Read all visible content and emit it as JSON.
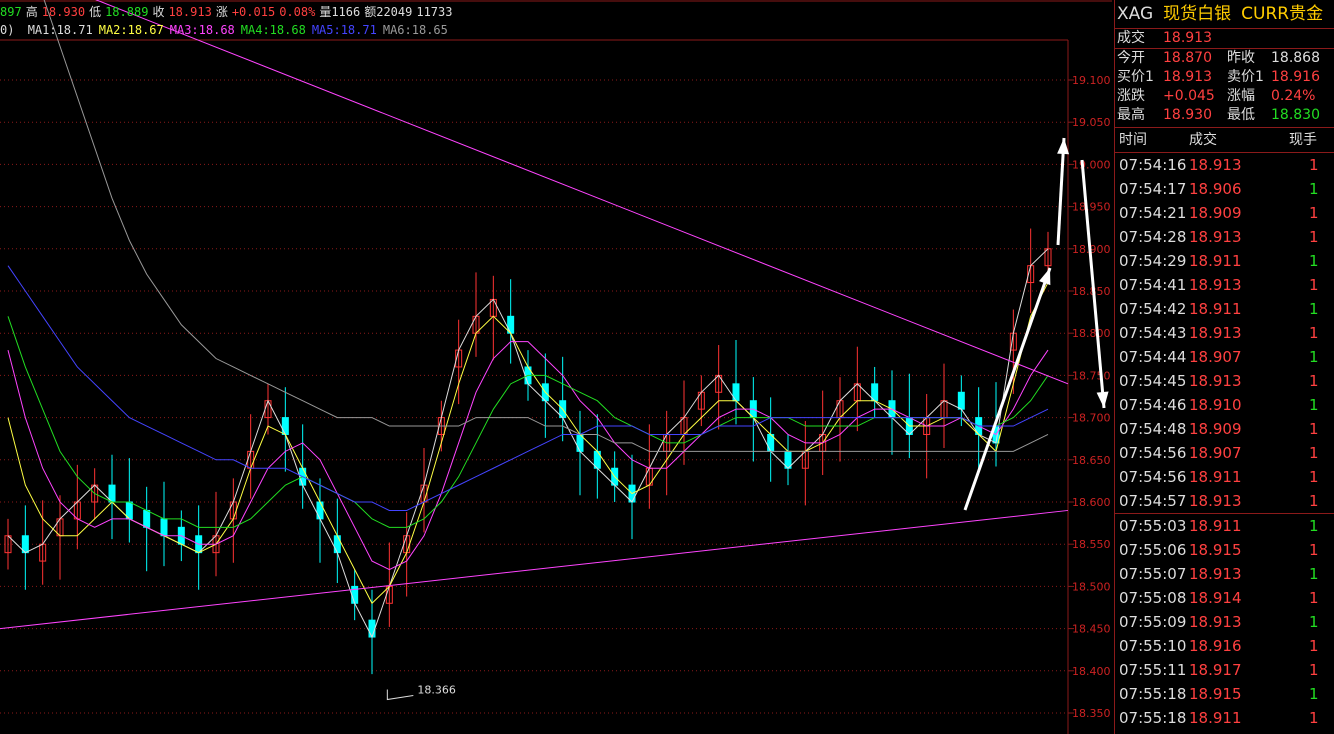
{
  "topbar": {
    "items": [
      {
        "text": "897",
        "color": "#22dd22"
      },
      {
        "text": "高",
        "color": "#dddddd"
      },
      {
        "text": "18.930",
        "color": "#ff4040"
      },
      {
        "text": "低",
        "color": "#dddddd"
      },
      {
        "text": "18.889",
        "color": "#22dd22"
      },
      {
        "text": "收",
        "color": "#dddddd"
      },
      {
        "text": "18.913",
        "color": "#ff4040"
      },
      {
        "text": "涨",
        "color": "#dddddd"
      },
      {
        "text": "+0.015",
        "color": "#ff4040"
      },
      {
        "text": "0.08%",
        "color": "#ff4040"
      },
      {
        "text": "量1166",
        "color": "#dddddd"
      },
      {
        "text": "额22049",
        "color": "#dddddd"
      },
      {
        "text": "11733",
        "color": "#dddddd"
      }
    ]
  },
  "ma_bar": {
    "prefix": "0)",
    "items": [
      {
        "text": "MA1:18.71",
        "color": "#dddddd"
      },
      {
        "text": "MA2:18.67",
        "color": "#ffff44"
      },
      {
        "text": "MA3:18.68",
        "color": "#ff44ff"
      },
      {
        "text": "MA4:18.68",
        "color": "#22dd22"
      },
      {
        "text": "MA5:18.71",
        "color": "#4444ff"
      },
      {
        "text": "MA6:18.65",
        "color": "#999999"
      }
    ]
  },
  "y_axis": {
    "labels": [
      "19.100",
      "19.050",
      "19.000",
      "18.950",
      "18.900",
      "18.850",
      "18.800",
      "18.750",
      "18.700",
      "18.650",
      "18.600",
      "18.550",
      "18.500",
      "18.450",
      "18.400",
      "18.350"
    ]
  },
  "annotation": {
    "low_label": "18.366"
  },
  "colors": {
    "up": "#ff3333",
    "down": "#00ffff",
    "trendline": "#ff44ff",
    "grid": "#8b1a1a",
    "arrow": "#ffffff"
  },
  "panel": {
    "title": {
      "symbol": "XAG",
      "name": "现货白银",
      "market": "CURR贵金"
    },
    "trade": {
      "label": "成交",
      "value": "18.913"
    },
    "quotes": [
      {
        "l1": "今开",
        "v1": "18.870",
        "c1": "#ff4040",
        "l2": "昨收",
        "v2": "18.868",
        "c2": "#dddddd"
      },
      {
        "l1": "买价1",
        "v1": "18.913",
        "c1": "#ff4040",
        "l2": "卖价1",
        "v2": "18.916",
        "c2": "#ff4040"
      },
      {
        "l1": "涨跌",
        "v1": "+0.045",
        "c1": "#ff4040",
        "l2": "涨幅",
        "v2": "0.24%",
        "c2": "#ff4040"
      },
      {
        "l1": "最高",
        "v1": "18.930",
        "c1": "#ff4040",
        "l2": "最低",
        "v2": "18.830",
        "c2": "#22dd22"
      }
    ],
    "table_head": {
      "time": "时间",
      "price": "成交",
      "vol": "现手"
    },
    "ticks": [
      {
        "time": "07:54:16",
        "price": "18.913",
        "vol": "1",
        "vc": "red"
      },
      {
        "time": "07:54:17",
        "price": "18.906",
        "vol": "1",
        "vc": "green"
      },
      {
        "time": "07:54:21",
        "price": "18.909",
        "vol": "1",
        "vc": "red"
      },
      {
        "time": "07:54:28",
        "price": "18.913",
        "vol": "1",
        "vc": "red"
      },
      {
        "time": "07:54:29",
        "price": "18.911",
        "vol": "1",
        "vc": "green"
      },
      {
        "time": "07:54:41",
        "price": "18.913",
        "vol": "1",
        "vc": "red"
      },
      {
        "time": "07:54:42",
        "price": "18.911",
        "vol": "1",
        "vc": "green"
      },
      {
        "time": "07:54:43",
        "price": "18.913",
        "vol": "1",
        "vc": "red"
      },
      {
        "time": "07:54:44",
        "price": "18.907",
        "vol": "1",
        "vc": "green"
      },
      {
        "time": "07:54:45",
        "price": "18.913",
        "vol": "1",
        "vc": "red"
      },
      {
        "time": "07:54:46",
        "price": "18.910",
        "vol": "1",
        "vc": "green"
      },
      {
        "time": "07:54:48",
        "price": "18.909",
        "vol": "1",
        "vc": "red"
      },
      {
        "time": "07:54:56",
        "price": "18.907",
        "vol": "1",
        "vc": "red"
      },
      {
        "time": "07:54:56",
        "price": "18.911",
        "vol": "1",
        "vc": "red"
      },
      {
        "time": "07:54:57",
        "price": "18.913",
        "vol": "1",
        "vc": "red"
      },
      {
        "time": "07:55:03",
        "price": "18.911",
        "vol": "1",
        "vc": "green"
      },
      {
        "time": "07:55:06",
        "price": "18.915",
        "vol": "1",
        "vc": "red"
      },
      {
        "time": "07:55:07",
        "price": "18.913",
        "vol": "1",
        "vc": "green"
      },
      {
        "time": "07:55:08",
        "price": "18.914",
        "vol": "1",
        "vc": "red"
      },
      {
        "time": "07:55:09",
        "price": "18.913",
        "vol": "1",
        "vc": "green"
      },
      {
        "time": "07:55:10",
        "price": "18.916",
        "vol": "1",
        "vc": "red"
      },
      {
        "time": "07:55:11",
        "price": "18.917",
        "vol": "1",
        "vc": "red"
      },
      {
        "time": "07:55:18",
        "price": "18.915",
        "vol": "1",
        "vc": "green"
      },
      {
        "time": "07:55:18",
        "price": "18.911",
        "vol": "1",
        "vc": "red"
      }
    ]
  },
  "chart_data": {
    "type": "candlestick",
    "ylim": [
      18.33,
      19.16
    ],
    "ma_lines": [
      {
        "name": "MA1",
        "color": "#dddddd",
        "values": [
          18.56,
          18.54,
          18.55,
          18.58,
          18.6,
          18.62,
          18.6,
          18.58,
          18.57,
          18.56,
          18.55,
          18.54,
          18.56,
          18.6,
          18.66,
          18.72,
          18.68,
          18.62,
          18.58,
          18.54,
          18.48,
          18.44,
          18.5,
          18.56,
          18.62,
          18.7,
          18.78,
          18.82,
          18.84,
          18.8,
          18.74,
          18.72,
          18.7,
          18.66,
          18.64,
          18.62,
          18.6,
          18.64,
          18.68,
          18.7,
          18.73,
          18.75,
          18.72,
          18.7,
          18.66,
          18.64,
          18.66,
          18.68,
          18.72,
          18.74,
          18.72,
          18.7,
          18.68,
          18.7,
          18.72,
          18.71,
          18.68,
          18.67,
          18.8,
          18.88,
          18.9
        ]
      },
      {
        "name": "MA2",
        "color": "#ffff44",
        "values": [
          18.7,
          18.62,
          18.58,
          18.56,
          18.56,
          18.58,
          18.6,
          18.58,
          18.57,
          18.56,
          18.55,
          18.54,
          18.55,
          18.58,
          18.64,
          18.69,
          18.68,
          18.64,
          18.6,
          18.56,
          18.52,
          18.48,
          18.5,
          18.54,
          18.6,
          18.67,
          18.74,
          18.8,
          18.82,
          18.8,
          18.76,
          18.73,
          18.71,
          18.68,
          18.66,
          18.63,
          18.61,
          18.62,
          18.65,
          18.68,
          18.7,
          18.72,
          18.72,
          18.7,
          18.68,
          18.66,
          18.66,
          18.67,
          18.7,
          18.72,
          18.72,
          18.71,
          18.69,
          18.69,
          18.7,
          18.7,
          18.68,
          18.66,
          18.74,
          18.82,
          18.86
        ]
      },
      {
        "name": "MA3",
        "color": "#ff44ff",
        "values": [
          18.78,
          18.7,
          18.64,
          18.6,
          18.58,
          18.57,
          18.58,
          18.58,
          18.57,
          18.56,
          18.56,
          18.55,
          18.55,
          18.56,
          18.6,
          18.64,
          18.66,
          18.67,
          18.65,
          18.61,
          18.57,
          18.53,
          18.52,
          18.53,
          18.56,
          18.61,
          18.67,
          18.73,
          18.77,
          18.79,
          18.79,
          18.77,
          18.75,
          18.72,
          18.7,
          18.67,
          18.65,
          18.64,
          18.64,
          18.66,
          18.68,
          18.7,
          18.71,
          18.71,
          18.7,
          18.68,
          18.67,
          18.67,
          18.68,
          18.7,
          18.71,
          18.71,
          18.7,
          18.69,
          18.69,
          18.7,
          18.69,
          18.68,
          18.71,
          18.75,
          18.78
        ]
      },
      {
        "name": "MA4",
        "color": "#22dd22",
        "values": [
          18.82,
          18.76,
          18.71,
          18.66,
          18.63,
          18.61,
          18.6,
          18.6,
          18.59,
          18.58,
          18.58,
          18.57,
          18.57,
          18.57,
          18.58,
          18.6,
          18.62,
          18.63,
          18.62,
          18.61,
          18.6,
          18.58,
          18.57,
          18.57,
          18.58,
          18.6,
          18.63,
          18.67,
          18.71,
          18.74,
          18.75,
          18.75,
          18.74,
          18.73,
          18.72,
          18.7,
          18.69,
          18.68,
          18.67,
          18.67,
          18.68,
          18.69,
          18.7,
          18.7,
          18.7,
          18.7,
          18.69,
          18.69,
          18.69,
          18.69,
          18.7,
          18.7,
          18.7,
          18.7,
          18.7,
          18.7,
          18.69,
          18.69,
          18.7,
          18.72,
          18.75
        ]
      },
      {
        "name": "MA5",
        "color": "#4444ff",
        "values": [
          18.88,
          18.85,
          18.82,
          18.79,
          18.76,
          18.74,
          18.72,
          18.7,
          18.69,
          18.68,
          18.67,
          18.66,
          18.65,
          18.65,
          18.64,
          18.64,
          18.64,
          18.63,
          18.62,
          18.61,
          18.6,
          18.6,
          18.59,
          18.59,
          18.6,
          18.61,
          18.62,
          18.63,
          18.64,
          18.65,
          18.66,
          18.67,
          18.68,
          18.68,
          18.69,
          18.69,
          18.69,
          18.68,
          18.68,
          18.68,
          18.68,
          18.69,
          18.69,
          18.69,
          18.7,
          18.7,
          18.7,
          18.7,
          18.7,
          18.7,
          18.7,
          18.7,
          18.7,
          18.7,
          18.7,
          18.7,
          18.69,
          18.69,
          18.69,
          18.7,
          18.71
        ]
      },
      {
        "name": "MA6",
        "color": "#999999",
        "values": [
          19.3,
          19.25,
          19.2,
          19.14,
          19.08,
          19.02,
          18.96,
          18.91,
          18.87,
          18.84,
          18.81,
          18.79,
          18.77,
          18.76,
          18.75,
          18.74,
          18.73,
          18.72,
          18.71,
          18.7,
          18.7,
          18.7,
          18.69,
          18.69,
          18.69,
          18.69,
          18.69,
          18.7,
          18.7,
          18.7,
          18.7,
          18.69,
          18.69,
          18.68,
          18.68,
          18.67,
          18.67,
          18.66,
          18.66,
          18.66,
          18.66,
          18.66,
          18.66,
          18.66,
          18.66,
          18.66,
          18.66,
          18.66,
          18.66,
          18.66,
          18.66,
          18.66,
          18.66,
          18.66,
          18.66,
          18.66,
          18.66,
          18.66,
          18.66,
          18.67,
          18.68
        ]
      }
    ],
    "trendlines": [
      {
        "name": "upper",
        "from": [
          0,
          19.24
        ],
        "to": [
          60,
          18.74
        ]
      },
      {
        "name": "lower",
        "from": [
          0,
          18.45
        ],
        "to": [
          60,
          18.59
        ]
      }
    ],
    "low_point": {
      "index": 22,
      "value": 18.366
    }
  }
}
